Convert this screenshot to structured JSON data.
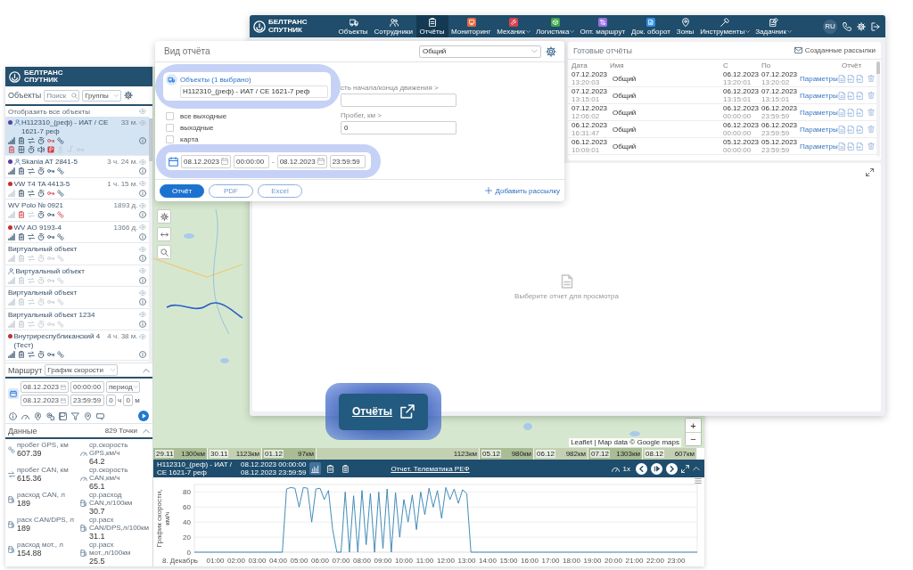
{
  "reports_window": {
    "logo": {
      "line_1": "БЕЛТРАНС",
      "line_2": "СПУТНИК"
    },
    "nav": [
      {
        "label": "Объекты",
        "selected": false,
        "dropdown": false
      },
      {
        "label": "Сотрудники",
        "selected": false,
        "dropdown": false
      },
      {
        "label": "Отчёты",
        "selected": true,
        "dropdown": false
      },
      {
        "label": "Мониторинг",
        "selected": false,
        "dropdown": false,
        "color": "#e8673c"
      },
      {
        "label": "Механик",
        "selected": false,
        "dropdown": true,
        "color": "#d8414d"
      },
      {
        "label": "Логистика",
        "selected": false,
        "dropdown": true,
        "color": "#3da64c"
      },
      {
        "label": "Опт. маршрут",
        "selected": false,
        "dropdown": false,
        "color": "#9b6fe3"
      },
      {
        "label": "Док. оборот",
        "selected": false,
        "dropdown": false,
        "color": "#2e8fe3"
      },
      {
        "label": "Зоны",
        "selected": false,
        "dropdown": false
      },
      {
        "label": "Инструменты",
        "selected": false,
        "dropdown": true
      },
      {
        "label": "Задачник",
        "selected": false,
        "dropdown": true
      }
    ],
    "language": "RU",
    "ready_reports": {
      "title": "Готовые отчёты",
      "mailings_link": "Созданные рассылки",
      "columns": [
        "Дата",
        "Имя",
        "С",
        "По",
        "Отчёт"
      ],
      "rows": [
        {
          "date": "07.12.2023",
          "time": "13:20:03",
          "name": "Общий",
          "from_date": "06.12.2023",
          "from_time": "13:20:01",
          "to_date": "07.12.2023",
          "to_time": "13:20:02",
          "link": "Параметры"
        },
        {
          "date": "07.12.2023",
          "time": "13:15:01",
          "name": "Общий",
          "from_date": "06.12.2023",
          "from_time": "13:15:01",
          "to_date": "07.12.2023",
          "to_time": "13:15:01",
          "link": "Параметры"
        },
        {
          "date": "07.12.2023",
          "time": "12:06:02",
          "name": "Общий",
          "from_date": "06.12.2023",
          "from_time": "00:00:00",
          "to_date": "06.12.2023",
          "to_time": "23:59:59",
          "link": "Параметры"
        },
        {
          "date": "06.12.2023",
          "time": "16:31:47",
          "name": "Общий",
          "from_date": "06.12.2023",
          "from_time": "00:00:00",
          "to_date": "06.12.2023",
          "to_time": "23:59:59",
          "link": "Параметры"
        },
        {
          "date": "06.12.2023",
          "time": "10:09:01",
          "name": "Общий",
          "from_date": "05.12.2023",
          "from_time": "00:00:00",
          "to_date": "05.12.2023",
          "to_time": "23:59:59",
          "link": "Параметры"
        }
      ]
    },
    "preview": {
      "hint": "Выберите отчет для просмотра"
    }
  },
  "report_dialog": {
    "title": "Вид отчёта",
    "report_type": "Общий",
    "objects": {
      "label": "Объекты (1 выбрано)",
      "value": "H112310_(реф) - ИАТ / CE 1621-7 реф"
    },
    "options": [
      {
        "label": "все выходные",
        "checked": false
      },
      {
        "label": "выходные",
        "checked": false
      },
      {
        "label": "карта",
        "checked": false
      }
    ],
    "fields": [
      {
        "label": "сть начала/конца движения >"
      },
      {
        "label": "Пробег, км >",
        "value": "0"
      }
    ],
    "period": {
      "from_date": "08.12.2023",
      "from_time": "00:00:00",
      "separator": "-",
      "to_date": "08.12.2023",
      "to_time": "23:59:59"
    },
    "buttons": [
      {
        "label": "Отчёт",
        "kind": "primary"
      },
      {
        "label": "PDF",
        "kind": "outline"
      },
      {
        "label": "Excel",
        "kind": "outline"
      }
    ],
    "add_mailing": "Добавить рассылку"
  },
  "tracking_window": {
    "logo": {
      "line_1": "БЕЛТРАНС",
      "line_2": "СПУТНИК"
    },
    "objects_panel": {
      "title": "Объекты",
      "search": {
        "placeholder": "Поиск"
      },
      "group_select": "Группы",
      "show_all": "Отобразить все объекты",
      "objects": [
        {
          "name": "H112310_(реф) - ИАТ / CE 1621-7 реф",
          "time": "33 м.",
          "selected": true,
          "driver": true,
          "color": "#5a3ea6",
          "sensors": [
            {
              "on": true,
              "alert": false
            },
            {
              "on": true,
              "alert": false
            },
            {
              "on": true,
              "alert": false
            },
            {
              "on": true,
              "alert": false
            },
            {
              "on": true,
              "alert": true
            },
            {
              "on": true,
              "alert": false
            }
          ],
          "extra_sensors": [
            {
              "on": true,
              "alert": true
            },
            {
              "on": true,
              "alert": false
            },
            {
              "on": true,
              "alert": false
            },
            {
              "on": true,
              "alert": false
            },
            {
              "on": true,
              "alert": true
            },
            {
              "on": false,
              "alert": false
            },
            {
              "on": false,
              "alert": false
            },
            {
              "on": false,
              "alert": false
            }
          ]
        },
        {
          "name": "Skania AT 2841-5",
          "time": "3 ч. 24 м.",
          "selected": false,
          "driver": true,
          "color": "#5a3ea6",
          "sensors": [
            {
              "on": true,
              "alert": false
            },
            {
              "on": true,
              "alert": false
            },
            {
              "on": true,
              "alert": false
            },
            {
              "on": true,
              "alert": false
            },
            {
              "on": true,
              "alert": false
            },
            {
              "on": true,
              "alert": false
            }
          ]
        },
        {
          "name": "VW T4 TA 4413-5",
          "time": "1 ч. 15 м.",
          "selected": false,
          "driver": false,
          "color": "#c62f2f",
          "sensors": [
            {
              "on": false,
              "alert": false
            },
            {
              "on": true,
              "alert": false
            },
            {
              "on": true,
              "alert": false
            },
            {
              "on": true,
              "alert": false
            },
            {
              "on": true,
              "alert": true
            },
            {
              "on": true,
              "alert": false
            }
          ]
        },
        {
          "name": "WV Polo № 0921",
          "time": "1893 д.",
          "selected": false,
          "driver": false,
          "sensors": [
            {
              "on": false,
              "alert": false
            },
            {
              "on": true,
              "alert": true
            },
            {
              "on": false,
              "alert": false
            },
            {
              "on": true,
              "alert": false
            },
            {
              "on": true,
              "alert": false
            },
            {
              "on": true,
              "alert": true
            }
          ]
        },
        {
          "name": "WV AO 9193-4",
          "time": "1366 д.",
          "selected": false,
          "driver": false,
          "color": "#c62f2f",
          "sensors": [
            {
              "on": true,
              "alert": false
            },
            {
              "on": true,
              "alert": false
            },
            {
              "on": true,
              "alert": false
            },
            {
              "on": true,
              "alert": false
            },
            {
              "on": true,
              "alert": false
            },
            {
              "on": true,
              "alert": false
            }
          ]
        },
        {
          "name": "Виртуальный объект",
          "selected": false,
          "driver": false,
          "sensors": [
            {
              "on": false,
              "alert": false
            },
            {
              "on": false,
              "alert": false
            },
            {
              "on": false,
              "alert": false
            },
            {
              "on": false,
              "alert": false
            },
            {
              "on": false,
              "alert": false
            },
            {
              "on": false,
              "alert": false
            }
          ]
        },
        {
          "name": "Виртуальный объект",
          "selected": false,
          "driver": true,
          "sensors": [
            {
              "on": false,
              "alert": false
            },
            {
              "on": false,
              "alert": false
            },
            {
              "on": false,
              "alert": false
            },
            {
              "on": false,
              "alert": false
            },
            {
              "on": false,
              "alert": false
            },
            {
              "on": false,
              "alert": false
            }
          ]
        },
        {
          "name": "Виртуальный объект",
          "selected": false,
          "driver": false,
          "sensors": [
            {
              "on": false,
              "alert": false
            },
            {
              "on": false,
              "alert": false
            },
            {
              "on": false,
              "alert": false
            },
            {
              "on": false,
              "alert": false
            },
            {
              "on": false,
              "alert": false
            },
            {
              "on": false,
              "alert": false
            }
          ]
        },
        {
          "name": "Виртуальный объект 1234",
          "selected": false,
          "driver": false,
          "sensors": [
            {
              "on": false,
              "alert": false
            },
            {
              "on": false,
              "alert": false
            },
            {
              "on": false,
              "alert": false
            },
            {
              "on": false,
              "alert": false
            },
            {
              "on": false,
              "alert": false
            },
            {
              "on": false,
              "alert": false
            }
          ]
        },
        {
          "name": "Внутриреспубликанский 4 (Тест)",
          "time": "4 ч. 38 м.",
          "selected": false,
          "driver": false,
          "color": "#c62f2f",
          "sensors": [
            {
              "on": true,
              "alert": false
            },
            {
              "on": true,
              "alert": false
            },
            {
              "on": true,
              "alert": false
            },
            {
              "on": true,
              "alert": false
            },
            {
              "on": true,
              "alert": false
            },
            {
              "on": true,
              "alert": false
            }
          ]
        }
      ]
    },
    "route_panel": {
      "title": "Маршрут",
      "chart_select": "График скорости",
      "expanded": true,
      "from_date": "08.12.2023",
      "from_time": "00:00:00",
      "period_select": "период",
      "to_date": "08.12.2023",
      "to_time": "23:59:59",
      "hours": "0",
      "hours_unit": "ч",
      "minutes": "0",
      "minutes_unit": "м"
    },
    "data_panel": {
      "title": "Данные",
      "points": "829 Точки",
      "expanded": true,
      "metrics": [
        {
          "label": "пробег GPS, км",
          "value": "607.39"
        },
        {
          "label": "ср.скорость GPS,км/ч",
          "value": "64.2"
        },
        {
          "label": "пробег CAN, км",
          "value": "615.36"
        },
        {
          "label": "ср.скорость CAN,км/ч",
          "value": "65.1"
        },
        {
          "label": "расход CAN, л",
          "value": "189"
        },
        {
          "label": "ср.расход CAN,л/100км",
          "value": "30.7"
        },
        {
          "label": "расх CAN/DPS, л",
          "value": "189"
        },
        {
          "label": "ср.расх CAN/DPS,л/100км",
          "value": "31.1"
        },
        {
          "label": "расход мот., л",
          "value": "154.88"
        },
        {
          "label": "ср.расх мот.,л/100км",
          "value": "25.5"
        }
      ]
    },
    "map": {
      "zoom_in": "+",
      "zoom_out": "−",
      "attribution": "Leaflet | Map data © Google maps",
      "timeline": [
        {
          "date": "29.11",
          "distance": "1300км"
        },
        {
          "date": "30.11",
          "distance": "1123км"
        },
        {
          "date": "01.12",
          "distance": "97км"
        },
        {
          "distance": "1123км"
        },
        {
          "date": "05.12",
          "distance": "980км"
        },
        {
          "date": "06.12",
          "distance": "982км"
        },
        {
          "date": "07.12",
          "distance": "1303км"
        },
        {
          "date": "08.12",
          "distance": "607км"
        }
      ]
    },
    "track_bar": {
      "object": "H112310_(реф) - ИАТ / CE 1621-7 реф",
      "from": "08.12.2023 00:00:00",
      "to": "08.12.2023 23:59:59",
      "views": [
        {
          "selected": true
        },
        {
          "selected": false
        },
        {
          "selected": false
        }
      ],
      "report_link": "Отчет. Телематика РЕФ",
      "speed": "1x"
    },
    "speed_chart": {
      "chart_data": {
        "type": "line",
        "xlabel": "8. Декабрь",
        "ylabel": "График скорости, км/ч",
        "x": [
          0,
          0.2,
          0.4,
          0.6,
          0.8,
          1,
          1.2,
          1.4,
          1.6,
          1.8,
          2,
          2.2,
          2.4,
          2.6,
          2.8,
          3,
          3.2,
          3.4,
          3.6,
          3.8,
          4,
          4.2,
          4.4,
          4.6,
          4.8,
          5,
          5.2,
          5.4,
          5.6,
          5.8,
          6,
          6.2,
          6.4,
          6.6,
          6.8,
          7,
          7.2,
          7.4,
          7.6,
          7.8,
          8,
          8.2,
          8.4,
          8.6,
          8.8,
          9,
          9.2,
          9.4,
          9.6,
          9.8,
          10,
          10.2,
          10.4,
          10.6,
          10.8,
          11,
          11.2,
          11.4,
          11.6,
          11.8,
          12,
          12.2,
          12.4,
          12.6,
          12.8,
          13,
          13.2,
          13.4,
          13.6,
          13.8,
          14,
          14.2,
          14.4,
          14.6,
          14.8,
          15,
          15.2,
          15.4,
          15.6,
          15.8,
          16,
          16.2,
          16.4,
          16.6,
          16.8,
          17,
          17.2,
          17.4,
          17.6,
          17.8,
          18,
          18.2,
          18.4,
          18.6,
          18.8,
          19,
          19.2,
          19.4,
          19.6,
          19.8,
          20,
          20.2,
          20.4,
          20.6,
          20.8,
          21,
          21.2,
          21.4,
          21.6,
          21.8,
          22,
          22.2,
          22.4,
          22.6,
          22.8,
          23,
          23.2,
          23.4,
          23.6,
          23.8,
          24
        ],
        "series": [
          {
            "color": "#2f7fb0",
            "values": [
              0,
              0,
              0,
              0,
              0,
              0,
              0,
              0,
              0,
              0,
              0,
              0,
              0,
              0,
              0,
              0,
              0,
              0,
              0,
              0,
              0,
              0,
              84,
              86,
              85,
              60,
              86,
              85,
              40,
              84,
              85,
              70,
              82,
              30,
              0,
              0,
              80,
              0,
              75,
              0,
              82,
              10,
              78,
              0,
              80,
              5,
              84,
              0,
              79,
              20,
              70,
              40,
              76,
              30,
              80,
              50,
              85,
              60,
              82,
              45,
              86,
              70,
              84,
              65,
              83,
              78,
              0,
              0,
              0,
              0,
              0,
              0,
              0,
              0,
              0,
              0,
              0,
              0,
              0,
              0,
              0,
              0,
              0,
              0,
              0,
              0,
              0,
              0,
              0,
              0,
              0,
              0,
              0,
              0,
              0,
              0,
              0,
              0,
              0,
              0,
              0,
              0,
              0,
              0,
              0,
              0,
              0,
              0,
              0,
              0,
              0,
              0,
              0,
              0,
              0,
              0,
              0,
              0,
              0,
              0,
              0
            ]
          }
        ],
        "xlim": [
          0,
          24
        ],
        "ylim": [
          0,
          90
        ],
        "grid": true,
        "xticks": [
          {
            "value": 1,
            "label": "01:00"
          },
          {
            "value": 2,
            "label": "02:00"
          },
          {
            "value": 3,
            "label": "03:00"
          },
          {
            "value": 4,
            "label": "04:00"
          },
          {
            "value": 5,
            "label": "05:00"
          },
          {
            "value": 6,
            "label": "06:00"
          },
          {
            "value": 7,
            "label": "07:00"
          },
          {
            "value": 8,
            "label": "08:00"
          },
          {
            "value": 9,
            "label": "09:00"
          },
          {
            "value": 10,
            "label": "10:00"
          },
          {
            "value": 11,
            "label": "11:00"
          },
          {
            "value": 12,
            "label": "12:00"
          },
          {
            "value": 13,
            "label": "13:00"
          },
          {
            "value": 14,
            "label": "14:00"
          },
          {
            "value": 15,
            "label": "15:00"
          },
          {
            "value": 16,
            "label": "16:00"
          },
          {
            "value": 17,
            "label": "17:00"
          },
          {
            "value": 18,
            "label": "18:00"
          },
          {
            "value": 19,
            "label": "19:00"
          },
          {
            "value": 20,
            "label": "20:00"
          },
          {
            "value": 21,
            "label": "21:00"
          },
          {
            "value": 22,
            "label": "22:00"
          },
          {
            "value": 23,
            "label": "23:00"
          }
        ],
        "yticks": [
          0,
          20,
          40,
          60,
          80
        ]
      }
    }
  },
  "reports_callout": {
    "label": "Отчёты"
  }
}
